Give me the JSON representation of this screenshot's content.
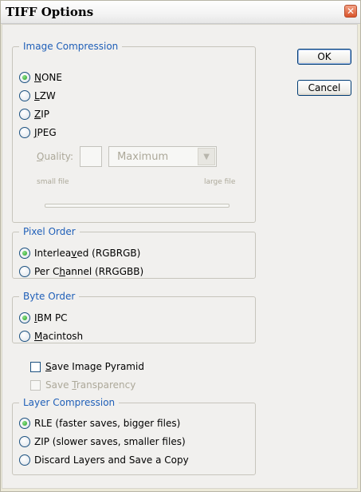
{
  "window": {
    "title": "TIFF Options",
    "close_icon": "close-icon"
  },
  "buttons": {
    "ok": "OK",
    "cancel": "Cancel"
  },
  "image_compression": {
    "legend": "Image Compression",
    "options": [
      {
        "pre": "",
        "key": "N",
        "post": "ONE",
        "selected": true
      },
      {
        "pre": "",
        "key": "L",
        "post": "ZW",
        "selected": false
      },
      {
        "pre": "",
        "key": "Z",
        "post": "IP",
        "selected": false
      },
      {
        "pre": "",
        "key": "J",
        "post": "PEG",
        "selected": false
      }
    ],
    "quality_label_key": "Q",
    "quality_label_rest": "uality:",
    "quality_value": "",
    "quality_select": "Maximum",
    "small_file": "small file",
    "large_file": "large file"
  },
  "pixel_order": {
    "legend": "Pixel Order",
    "options": [
      {
        "pre": "Interlea",
        "key": "v",
        "post": "ed (RGBRGB)",
        "selected": true
      },
      {
        "pre": "Per C",
        "key": "h",
        "post": "annel (RRGGBB)",
        "selected": false
      }
    ]
  },
  "byte_order": {
    "legend": "Byte Order",
    "options": [
      {
        "pre": "",
        "key": "I",
        "post": "BM PC",
        "selected": true
      },
      {
        "pre": "",
        "key": "M",
        "post": "acintosh",
        "selected": false
      }
    ]
  },
  "checkboxes": {
    "save_pyramid": {
      "pre": "",
      "key": "S",
      "post": "ave Image Pyramid",
      "checked": false,
      "enabled": true
    },
    "save_transparency": {
      "pre": "Save ",
      "key": "T",
      "post": "ransparency",
      "checked": false,
      "enabled": false
    }
  },
  "layer_compression": {
    "legend": "Layer Compression",
    "options": [
      {
        "label": "RLE (faster saves, bigger files)",
        "selected": true
      },
      {
        "label": "ZIP (slower saves, smaller files)",
        "selected": false
      },
      {
        "label": "Discard Layers and Save a Copy",
        "selected": false
      }
    ]
  }
}
